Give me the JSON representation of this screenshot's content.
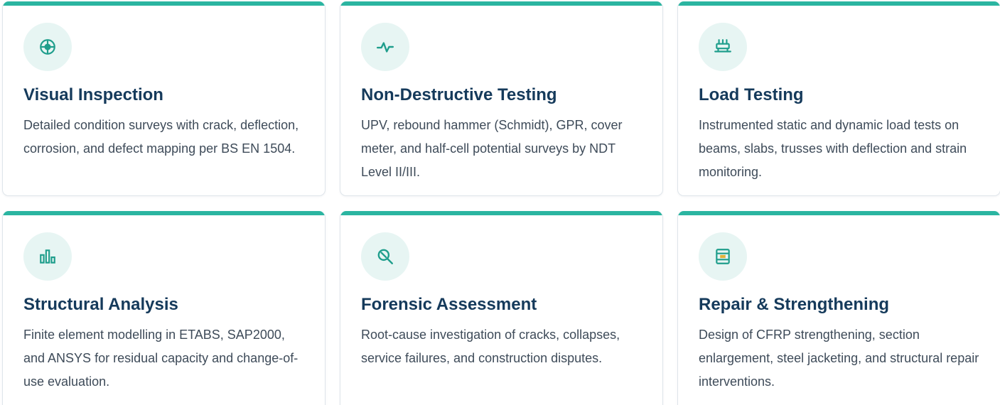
{
  "accent_color": "#2bb5a1",
  "title_color": "#153a5b",
  "services": [
    {
      "icon": "crosshair-icon",
      "title": "Visual Inspection",
      "description": "Detailed condition surveys with crack, deflection, corrosion, and defect mapping per BS EN 1504."
    },
    {
      "icon": "pulse-icon",
      "title": "Non-Destructive Testing",
      "description": "UPV, rebound hammer (Schmidt), GPR, cover meter, and half-cell potential surveys by NDT Level II/III."
    },
    {
      "icon": "load-frame-icon",
      "title": "Load Testing",
      "description": "Instrumented static and dynamic load tests on beams, slabs, trusses with deflection and strain monitoring."
    },
    {
      "icon": "bar-chart-icon",
      "title": "Structural Analysis",
      "description": "Finite element modelling in ETABS, SAP2000, and ANSYS for residual capacity and change-of-use evaluation."
    },
    {
      "icon": "magnifier-icon",
      "title": "Forensic Assessment",
      "description": "Root-cause investigation of cracks, collapses, service failures, and construction disputes."
    },
    {
      "icon": "repair-panel-icon",
      "title": "Repair & Strengthening",
      "description": "Design of CFRP strengthening, section enlargement, steel jacketing, and structural repair interventions."
    }
  ]
}
